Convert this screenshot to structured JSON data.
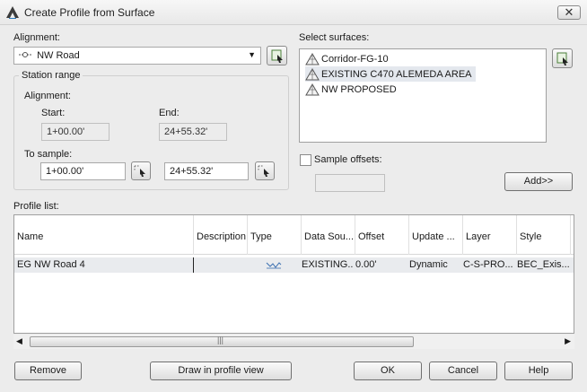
{
  "window": {
    "title": "Create Profile from Surface"
  },
  "alignment": {
    "label": "Alignment:",
    "selected": "NW Road"
  },
  "station_range": {
    "label": "Station range",
    "alignment_label": "Alignment:",
    "start_label": "Start:",
    "start_value": "1+00.00'",
    "end_label": "End:",
    "end_value": "24+55.32'",
    "to_sample_label": "To sample:",
    "sample_start": "1+00.00'",
    "sample_end": "24+55.32'"
  },
  "surfaces": {
    "label": "Select surfaces:",
    "items": [
      {
        "name": "Corridor-FG-10"
      },
      {
        "name": "EXISTING C470 ALEMEDA AREA"
      },
      {
        "name": "NW PROPOSED"
      }
    ]
  },
  "sample_offsets": {
    "label": "Sample offsets:",
    "value": ""
  },
  "add_button": "Add>>",
  "profile_list": {
    "label": "Profile list:",
    "columns": [
      "Name",
      "Description",
      "Type",
      "Data Sou...",
      "Offset",
      "Update ...",
      "Layer",
      "Style"
    ],
    "rows": [
      {
        "name": "EG NW Road 4",
        "description": "",
        "data_source": "EXISTING...",
        "offset": "0.00'",
        "update": "Dynamic",
        "layer": "C-S-PRO...",
        "style": "BEC_Exis..."
      }
    ]
  },
  "buttons": {
    "remove": "Remove",
    "draw": "Draw in profile view",
    "ok": "OK",
    "cancel": "Cancel",
    "help": "Help"
  },
  "colors": {
    "selection": "#e4e8ee",
    "line_icon": "#3a6fb0"
  }
}
